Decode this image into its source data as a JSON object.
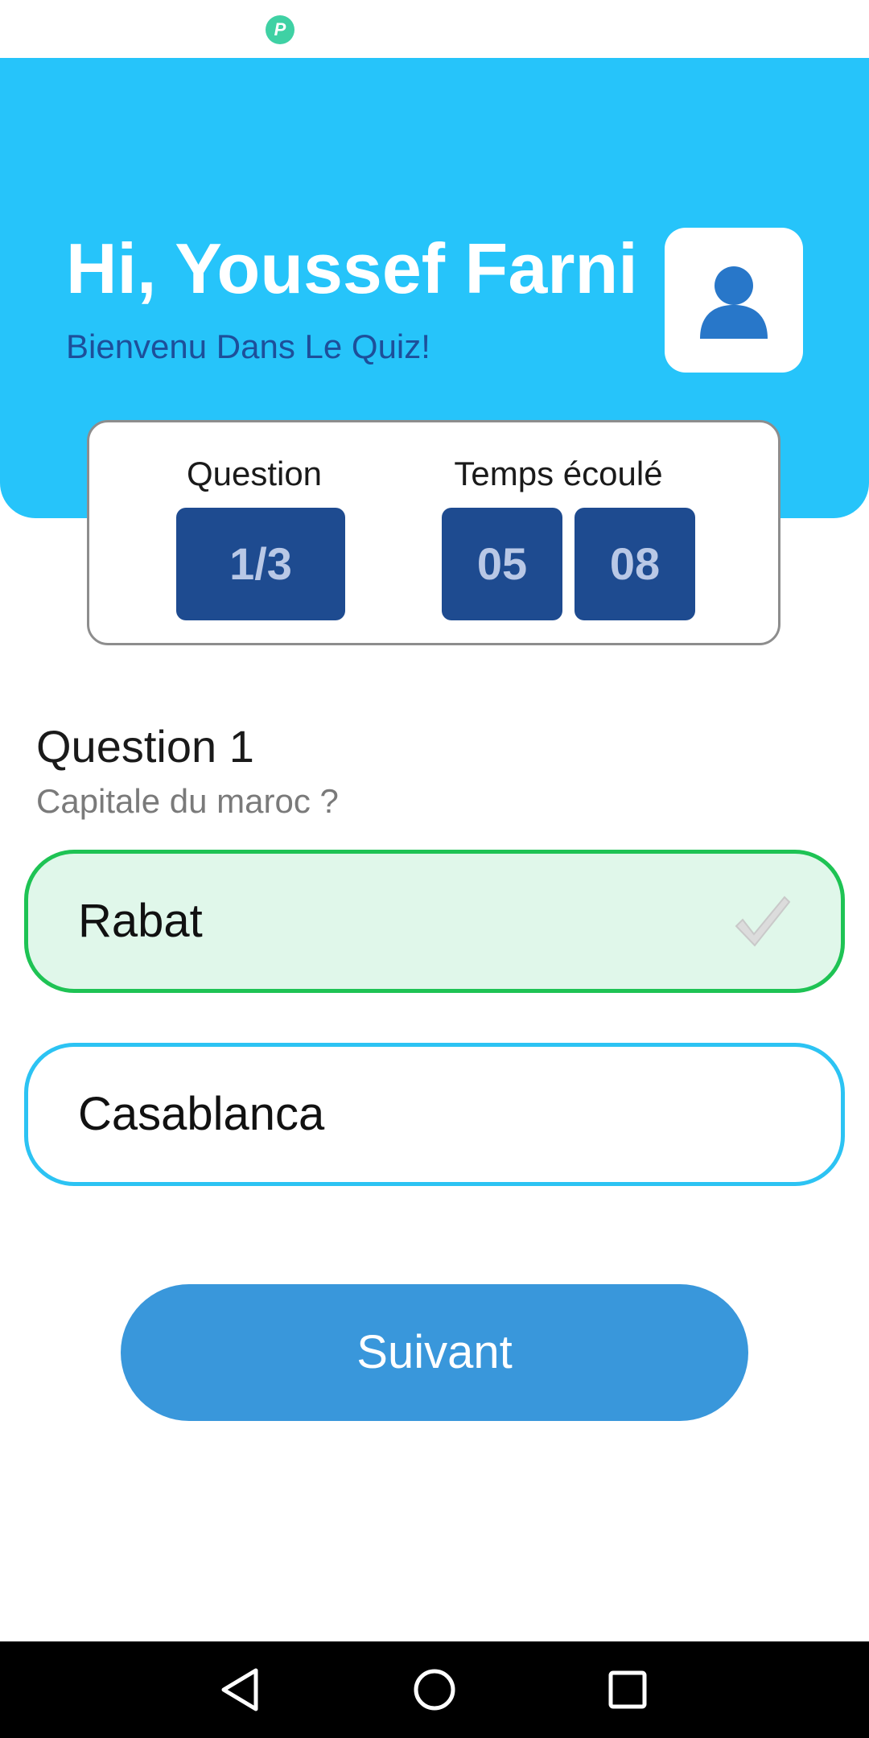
{
  "status_bar": {
    "app_icon": "p-notification-icon",
    "app_icon_glyph": "P"
  },
  "header": {
    "greeting": "Hi, Youssef Farni",
    "subtitle": "Bienvenu Dans Le Quiz!",
    "avatar_icon": "user-icon",
    "background_color": "#26c4fa"
  },
  "stats": {
    "question_label": "Question",
    "question_progress": "1/3",
    "time_label": "Temps écoulé",
    "time_minutes": "05",
    "time_seconds": "08",
    "box_color": "#1e4b90"
  },
  "question": {
    "title": "Question 1",
    "text": "Capitale du maroc ?"
  },
  "options": [
    {
      "label": "Rabat",
      "selected": true,
      "icon": "checkmark-icon"
    },
    {
      "label": "Casablanca",
      "selected": false
    }
  ],
  "actions": {
    "next_label": "Suivant"
  },
  "nav_bar": {
    "back": "back-triangle-icon",
    "home": "home-circle-icon",
    "recents": "recents-square-icon"
  }
}
